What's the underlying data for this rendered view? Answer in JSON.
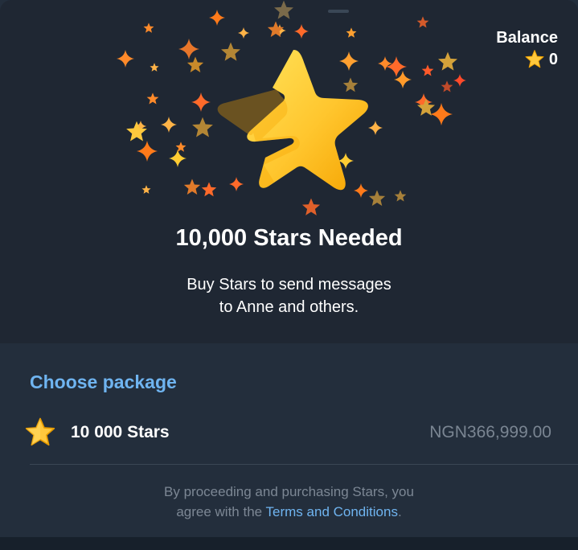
{
  "balance": {
    "label": "Balance",
    "value": "0",
    "icon": "star-icon"
  },
  "hero": {
    "icon": "telegram-star-icon",
    "title": "10,000 Stars Needed",
    "subtitle_line1": "Buy Stars to send messages",
    "subtitle_line2": "to Anne and others."
  },
  "packages": {
    "header": "Choose package",
    "items": [
      {
        "label": "10 000 Stars",
        "price": "NGN366,999.00",
        "icon": "star-icon"
      }
    ]
  },
  "footer": {
    "line1": "By proceeding and purchasing Stars, you",
    "line2_prefix": "agree with the ",
    "link": "Terms and Conditions",
    "line2_suffix": "."
  },
  "colors": {
    "accent": "#6fb4f0",
    "star_gold": "#ffc83d",
    "background": "#1f2733"
  }
}
